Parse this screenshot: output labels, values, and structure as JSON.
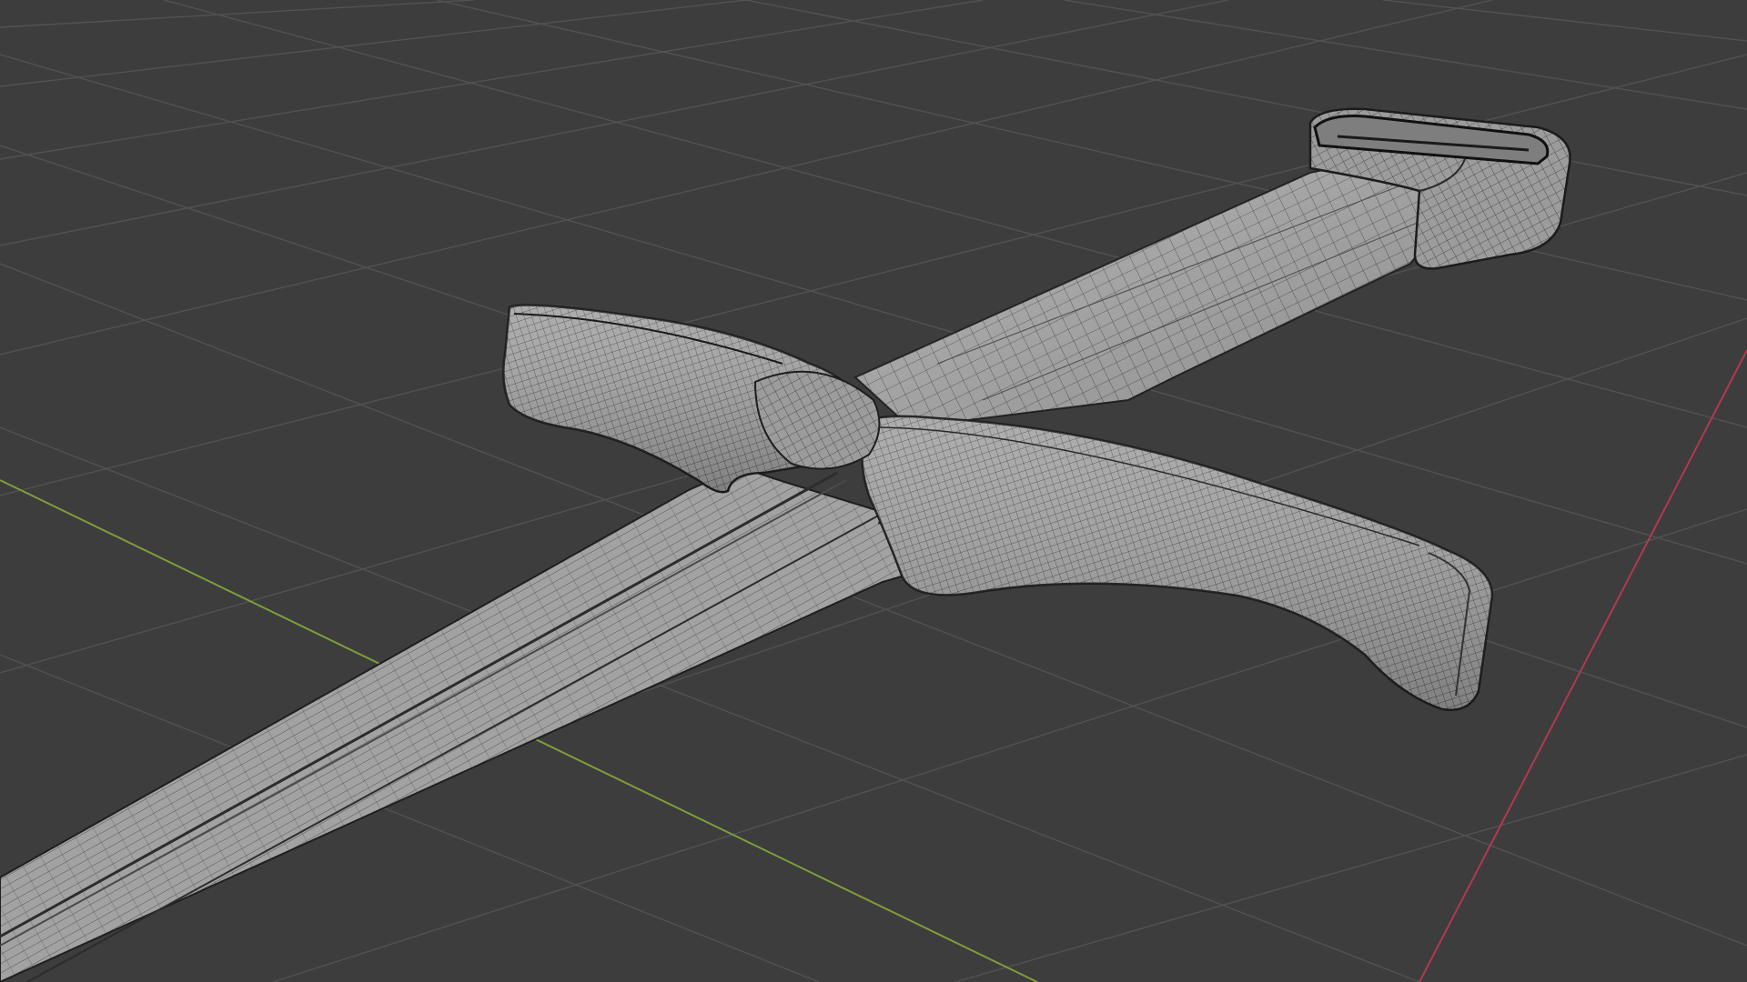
{
  "viewport": {
    "type": "3d-viewport",
    "shading": "solid-wireframe",
    "object": "sword-hilt-mesh",
    "parts": [
      "blade",
      "crossguard-left",
      "crossguard-right",
      "grip",
      "pommel"
    ],
    "axes": {
      "x_axis": {
        "label": "X",
        "color": "#c8455a"
      },
      "y_axis": {
        "label": "Y",
        "color": "#8bb13a"
      }
    },
    "colors": {
      "background": "#3d3d3d",
      "grid_line": "#4f4f4f",
      "mesh_surface": "#9a9a9a",
      "mesh_wire": "#2a2a2a"
    },
    "grid": true
  }
}
